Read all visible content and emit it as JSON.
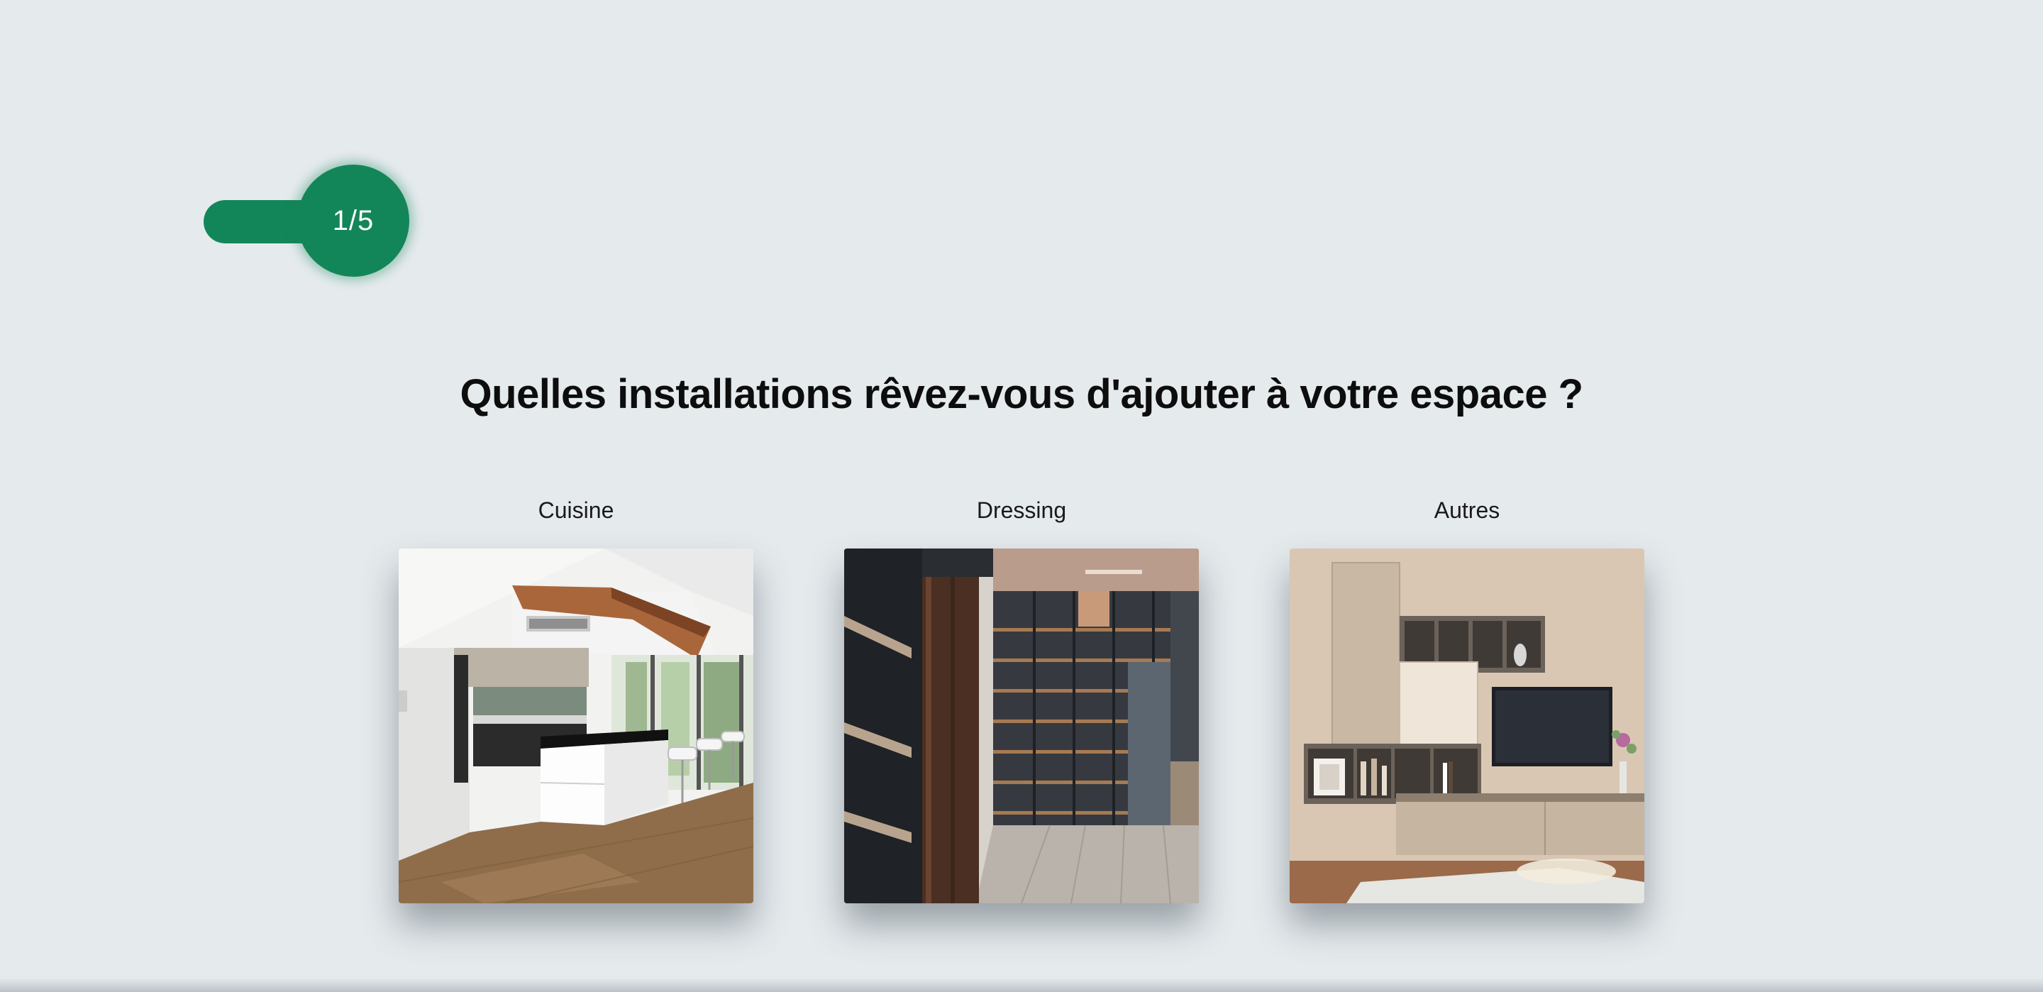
{
  "progress": {
    "label": "1/5",
    "current": 1,
    "total": 5,
    "fraction": 0.2,
    "color": "#138659"
  },
  "question": {
    "title": "Quelles installations rêvez-vous d'ajouter à votre espace ?"
  },
  "options": [
    {
      "label": "Cuisine"
    },
    {
      "label": "Dressing"
    },
    {
      "label": "Autres"
    }
  ]
}
